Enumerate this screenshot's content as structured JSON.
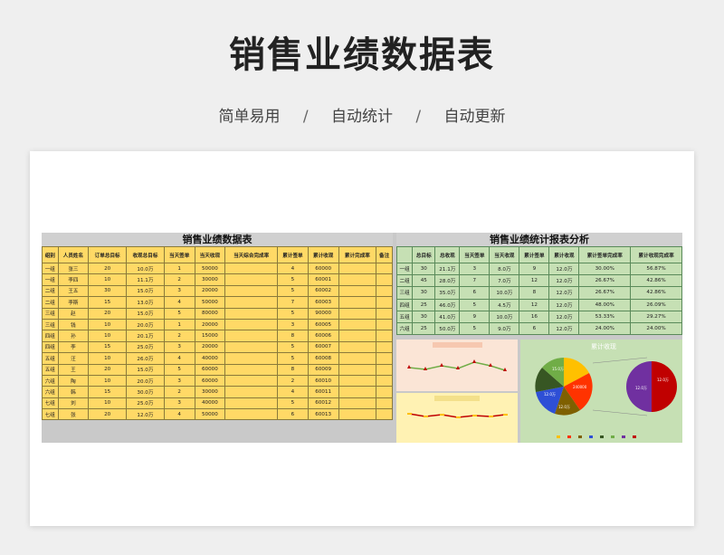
{
  "header": {
    "title": "销售业绩数据表",
    "subtitle_items": [
      "简单易用",
      "自动统计",
      "自动更新"
    ],
    "separator": "/"
  },
  "left": {
    "title": "销售业绩数据表",
    "columns": [
      "组别",
      "人员姓名",
      "订单总目标",
      "收现总目标",
      "当天签单",
      "当天收现",
      "当天综合完成率",
      "累计签单",
      "累计收现",
      "累计完成率",
      "备注"
    ],
    "rows": [
      [
        "一组",
        "张三",
        "20",
        "10.0万",
        "1",
        "50000",
        "",
        "4",
        "60000",
        "",
        ""
      ],
      [
        "一组",
        "李四",
        "10",
        "11.1万",
        "2",
        "30000",
        "",
        "5",
        "60001",
        "",
        ""
      ],
      [
        "二组",
        "王五",
        "30",
        "15.0万",
        "3",
        "20000",
        "",
        "5",
        "60002",
        "",
        ""
      ],
      [
        "二组",
        "李斯",
        "15",
        "13.0万",
        "4",
        "50000",
        "",
        "7",
        "60003",
        "",
        ""
      ],
      [
        "三组",
        "赵",
        "20",
        "15.0万",
        "5",
        "80000",
        "",
        "5",
        "90000",
        "",
        ""
      ],
      [
        "三组",
        "钱",
        "10",
        "20.0万",
        "1",
        "20000",
        "",
        "3",
        "60005",
        "",
        ""
      ],
      [
        "四组",
        "孙",
        "10",
        "20.1万",
        "2",
        "15000",
        "",
        "8",
        "60006",
        "",
        ""
      ],
      [
        "四组",
        "李",
        "15",
        "25.0万",
        "3",
        "20000",
        "",
        "5",
        "60007",
        "",
        ""
      ],
      [
        "五组",
        "汪",
        "10",
        "26.0万",
        "4",
        "40000",
        "",
        "5",
        "60008",
        "",
        ""
      ],
      [
        "五组",
        "王",
        "20",
        "15.0万",
        "5",
        "60000",
        "",
        "8",
        "60009",
        "",
        ""
      ],
      [
        "六组",
        "陶",
        "10",
        "20.0万",
        "3",
        "60000",
        "",
        "2",
        "60010",
        "",
        ""
      ],
      [
        "六组",
        "韩",
        "15",
        "30.0万",
        "2",
        "30000",
        "",
        "4",
        "60011",
        "",
        ""
      ],
      [
        "七组",
        "刘",
        "10",
        "25.0万",
        "3",
        "40000",
        "",
        "5",
        "60012",
        "",
        ""
      ],
      [
        "七组",
        "张",
        "20",
        "12.0万",
        "4",
        "50000",
        "",
        "6",
        "60013",
        "",
        ""
      ]
    ]
  },
  "right": {
    "title": "销售业绩统计报表分析",
    "columns": [
      "",
      "总目标",
      "总收现",
      "当天签单",
      "当天收现",
      "累计签单",
      "累计收现",
      "累计签单完成率",
      "累计收现完成率"
    ],
    "rows": [
      [
        "一组",
        "30",
        "21.1万",
        "3",
        "8.0万",
        "9",
        "12.0万",
        "30.00%",
        "56.87%"
      ],
      [
        "二组",
        "45",
        "28.0万",
        "7",
        "7.0万",
        "12",
        "12.0万",
        "26.67%",
        "42.86%"
      ],
      [
        "三组",
        "30",
        "35.0万",
        "6",
        "10.0万",
        "8",
        "12.0万",
        "26.67%",
        "42.86%"
      ],
      [
        "四组",
        "25",
        "46.0万",
        "5",
        "4.5万",
        "12",
        "12.0万",
        "48.00%",
        "26.09%"
      ],
      [
        "五组",
        "30",
        "41.0万",
        "9",
        "10.0万",
        "16",
        "12.0万",
        "53.33%",
        "29.27%"
      ],
      [
        "六组",
        "25",
        "50.0万",
        "5",
        "9.0万",
        "6",
        "12.0万",
        "24.00%",
        "24.00%"
      ]
    ]
  },
  "charts": {
    "cumulative_title": "累计收现",
    "pie1_labels": [
      "15.0万",
      "12.0万",
      "12.0万",
      "240000"
    ],
    "pie2_labels": [
      "12.0万",
      "12.0万"
    ],
    "colors": {
      "red": "#c00000",
      "green": "#70ad47",
      "orange": "#ff6600",
      "yellow": "#ffc000",
      "blue": "#2e4fd6",
      "purple": "#7030a0",
      "dkgreen": "#375623",
      "brown": "#7f6000"
    }
  }
}
